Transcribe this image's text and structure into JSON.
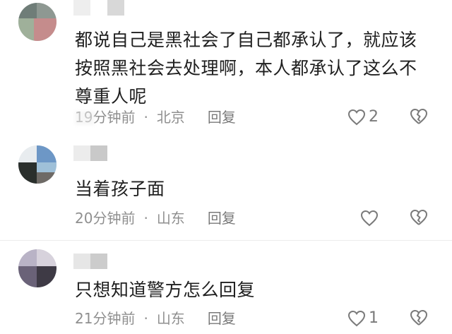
{
  "comments": [
    {
      "content": "都说自己是黑社会了自己都承认了，就应该按照黑社会去处理啊，本人都承认了这么不尊重人呢",
      "time": "19分钟前",
      "location": "北京",
      "reply": "回复",
      "likes": "2"
    },
    {
      "content": "当着孩子面",
      "time": "20分钟前",
      "location": "山东",
      "reply": "回复",
      "likes": ""
    },
    {
      "content": "只想知道警方怎么回复",
      "time": "21分钟前",
      "location": "山东",
      "reply": "回复",
      "likes": "1"
    }
  ],
  "colors": {
    "text": "#1f1f1f",
    "meta": "#8f8f8f",
    "icon": "#7a7a7a"
  },
  "icons": {
    "like": "heart-outline-icon",
    "dislike": "broken-heart-icon"
  }
}
